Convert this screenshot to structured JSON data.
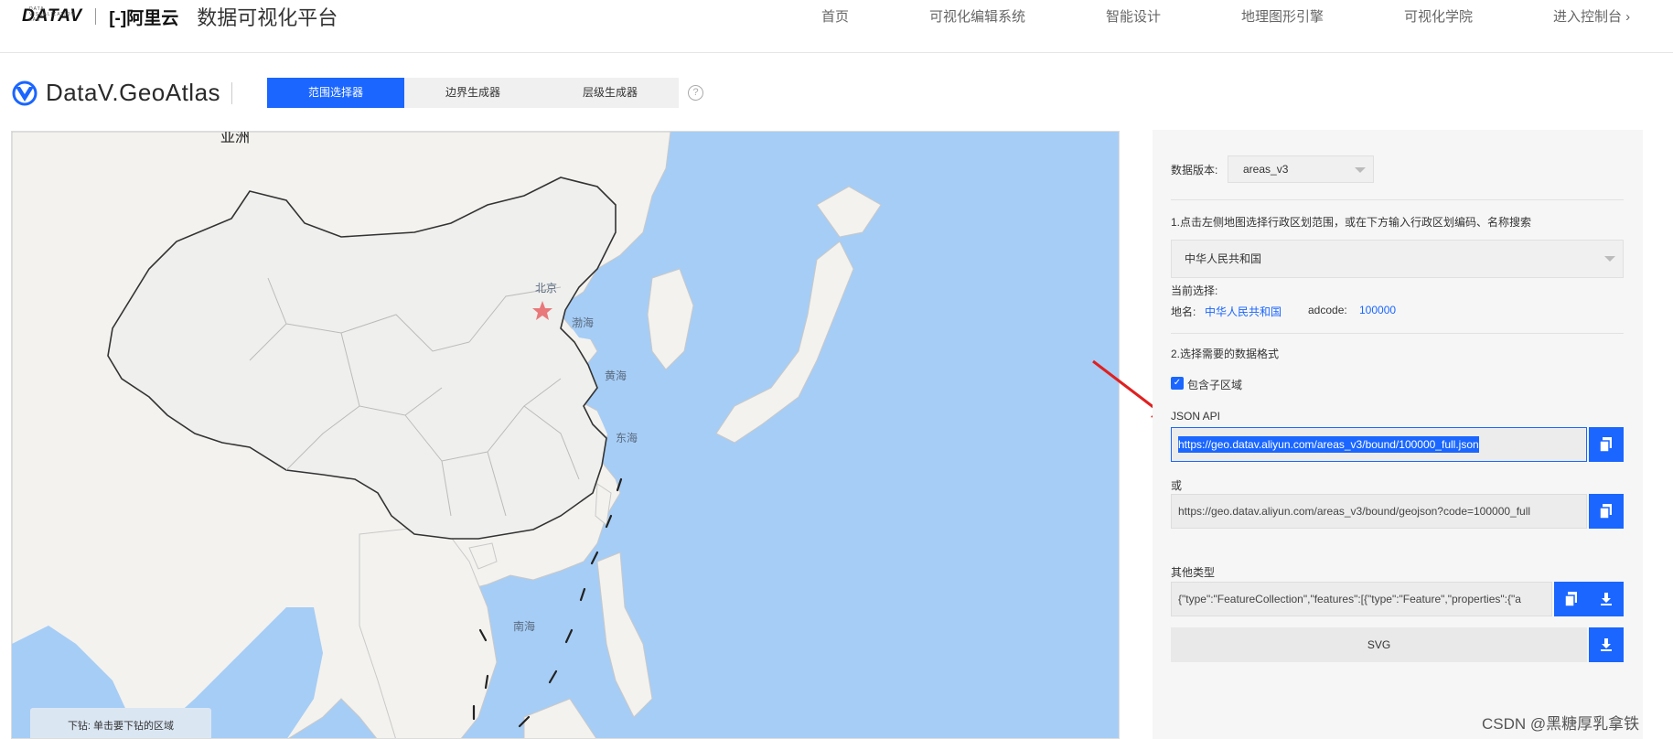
{
  "topnav": {
    "logo_text": "DATAV",
    "logo_tiny": "DATA VISUALIZATION LAB",
    "aliyun_text": "[-]阿里云",
    "title": "数据可视化平台",
    "links": [
      "首页",
      "可视化编辑系统",
      "智能设计",
      "地理图形引擎",
      "可视化学院",
      "进入控制台 ›"
    ]
  },
  "product": {
    "name": "DataV.GeoAtlas",
    "tabs": [
      "范围选择器",
      "边界生成器",
      "层级生成器"
    ],
    "help": "?"
  },
  "map": {
    "labels": {
      "continent": "亚洲",
      "beijing": "北京",
      "bohai": "渤海",
      "huanghai": "黄海",
      "donghai": "东海",
      "nanhai": "南海"
    },
    "hint": "下钻:   单击要下钻的区域"
  },
  "panel": {
    "version_label": "数据版本:",
    "version_value": "areas_v3",
    "step1": "1.点击左侧地图选择行政区划范围，或在下方输入行政区划编码、名称搜索",
    "region_select": "中华人民共和国",
    "current_label": "当前选择:",
    "name_label": "地名:",
    "name_value": "中华人民共和国",
    "adcode_label": "adcode:",
    "adcode_value": "100000",
    "step2": "2.选择需要的数据格式",
    "include_children": "包含子区域",
    "json_api_label": "JSON API",
    "json_api_url": "https://geo.datav.aliyun.com/areas_v3/bound/100000_full.json",
    "or_label": "或",
    "alt_url": "https://geo.datav.aliyun.com/areas_v3/bound/geojson?code=100000_full",
    "other_label": "其他类型",
    "geojson_preview": "{\"type\":\"FeatureCollection\",\"features\":[{\"type\":\"Feature\",\"properties\":{\"a",
    "svg_label": "SVG"
  },
  "watermark": "CSDN @黑糖厚乳拿铁",
  "colors": {
    "accent": "#1a66ff",
    "sea": "#a6cdf5",
    "land": "#f3f2ef",
    "annotation": "#e02020"
  }
}
